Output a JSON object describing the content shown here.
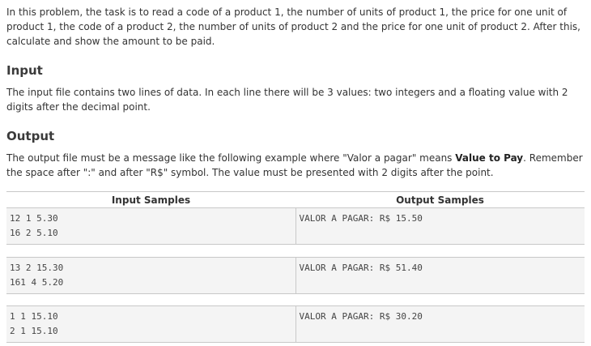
{
  "statement": "In this problem, the task is to read a code of a product 1, the number of units of product 1, the price for one unit of product 1, the code of a product 2, the number of units of product 2 and the price for one unit of product 2. After this, calculate and show the amount to be paid.",
  "input": {
    "title": "Input",
    "description": "The input file contains two lines of data. In each line there will be 3 values: two integers and a floating value with 2 digits after the decimal point."
  },
  "output": {
    "title": "Output",
    "description_before": "The output file must be a message like the following example where \"Valor a pagar\" means ",
    "description_bold": "Value to Pay",
    "description_after": ". Remember the space after \":\" and after \"R$\" symbol. The value must be presented with 2 digits after the point."
  },
  "samples": {
    "input_header": "Input Samples",
    "output_header": "Output Samples",
    "rows": [
      {
        "input_line1": "12 1 5.30",
        "input_line2": "16 2 5.10",
        "output": "VALOR A PAGAR: R$ 15.50"
      },
      {
        "input_line1": "13 2 15.30",
        "input_line2": "161 4 5.20",
        "output": "VALOR A PAGAR: R$ 51.40"
      },
      {
        "input_line1": "1 1 15.10",
        "input_line2": "2 1 15.10",
        "output": "VALOR A PAGAR: R$ 30.20"
      }
    ]
  }
}
